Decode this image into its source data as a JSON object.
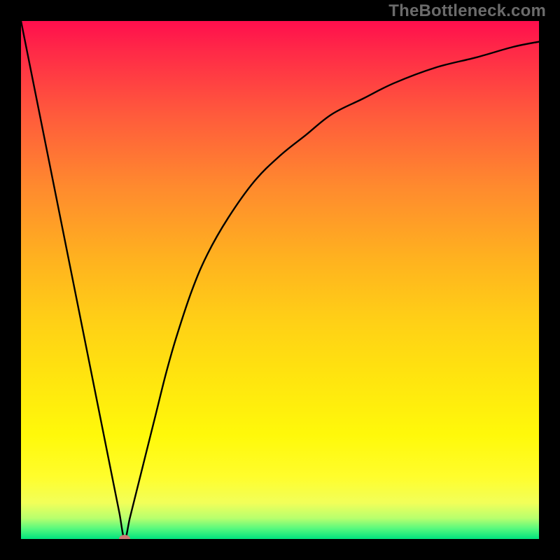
{
  "watermark": "TheBottleneck.com",
  "chart_data": {
    "type": "line",
    "title": "",
    "xlabel": "",
    "ylabel": "",
    "xlim": [
      0,
      100
    ],
    "ylim": [
      0,
      100
    ],
    "grid": false,
    "series": [
      {
        "name": "curve",
        "x": [
          0,
          2,
          4,
          6,
          8,
          10,
          12,
          14,
          16,
          18,
          19,
          20,
          21,
          22,
          24,
          26,
          28,
          30,
          33,
          36,
          40,
          45,
          50,
          55,
          60,
          66,
          72,
          80,
          88,
          95,
          100
        ],
        "y": [
          100,
          90,
          80,
          70,
          60,
          50,
          40,
          30,
          20,
          10,
          5,
          0,
          4,
          8,
          16,
          24,
          32,
          39,
          48,
          55,
          62,
          69,
          74,
          78,
          82,
          85,
          88,
          91,
          93,
          95,
          96
        ]
      }
    ],
    "marker": {
      "x": 20,
      "y": 0
    },
    "background": "red-yellow-green-vertical-gradient"
  },
  "colors": {
    "frame": "#000000",
    "curve": "#000000",
    "marker": "#cc7a75",
    "watermark": "#6b6b6b"
  }
}
